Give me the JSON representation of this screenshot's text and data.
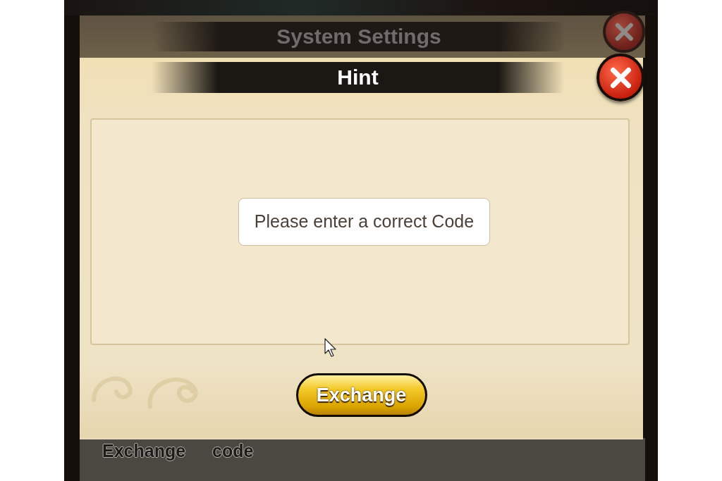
{
  "background_dialog": {
    "title": "System Settings",
    "dimmed": true,
    "labels": [
      "Exchange",
      "code"
    ]
  },
  "dialog": {
    "title": "Hint",
    "message": "Please enter a correct Code",
    "button": "Exchange"
  }
}
